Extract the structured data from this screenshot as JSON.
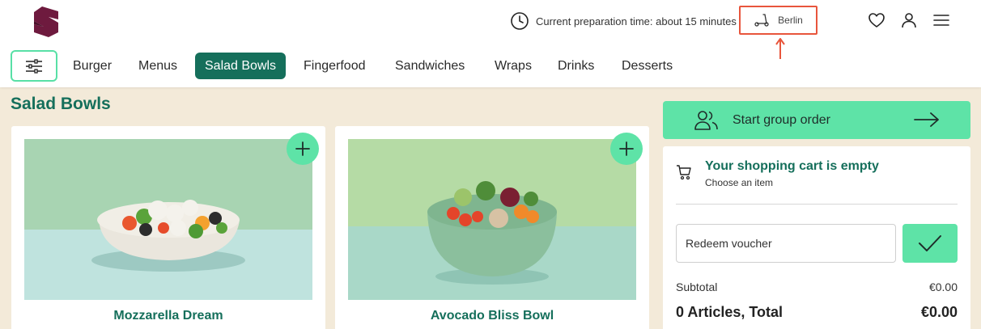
{
  "header": {
    "prep_time": "Current preparation time: about 15 minutes",
    "location": "Berlin"
  },
  "nav": {
    "categories": [
      {
        "label": "Burger",
        "active": false
      },
      {
        "label": "Menus",
        "active": false
      },
      {
        "label": "Salad Bowls",
        "active": true
      },
      {
        "label": "Fingerfood",
        "active": false
      },
      {
        "label": "Sandwiches",
        "active": false
      },
      {
        "label": "Wraps",
        "active": false
      },
      {
        "label": "Drinks",
        "active": false
      },
      {
        "label": "Desserts",
        "active": false
      }
    ]
  },
  "section": {
    "title": "Salad Bowls"
  },
  "products": [
    {
      "name": "Mozzarella Dream"
    },
    {
      "name": "Avocado Bliss Bowl"
    }
  ],
  "group_order": {
    "label": "Start group order"
  },
  "cart": {
    "empty_title": "Your shopping cart is empty",
    "empty_subtitle": "Choose an item",
    "voucher_placeholder": "Redeem voucher",
    "subtotal_label": "Subtotal",
    "subtotal_value": "€0.00",
    "total_label": "0 Articles, Total",
    "total_value": "€0.00"
  },
  "icons": {
    "logo": "brand-logo-icon",
    "clock": "clock-icon",
    "location": "scooter-icon",
    "annotation": "red-arrow-up-icon",
    "favorites": "heart-icon",
    "account": "user-icon",
    "menu": "hamburger-menu-icon",
    "filter": "sliders-icon",
    "add": "plus-icon",
    "group": "users-icon",
    "arrow": "arrow-right-icon",
    "cart": "cart-icon",
    "apply": "checkmark-icon"
  },
  "colors": {
    "brand_dark_green": "#156f5b",
    "mint": "#5ee3a7",
    "logo": "#6e1a3e",
    "annotation_red": "#e8553c",
    "page_bg": "#f3ead9"
  }
}
